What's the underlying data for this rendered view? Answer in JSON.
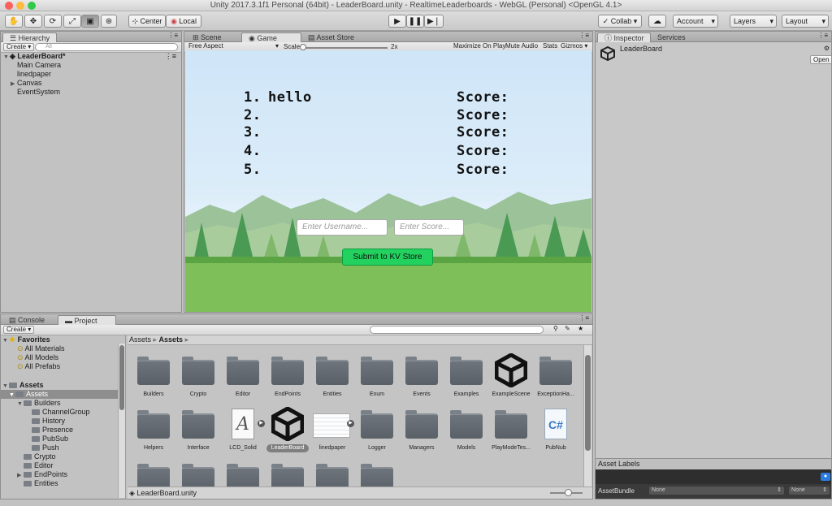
{
  "window": {
    "title": "Unity 2017.3.1f1 Personal (64bit) - LeaderBoard.unity - RealtimeLeaderboards - WebGL (Personal) <OpenGL 4.1>"
  },
  "toolbar": {
    "tools": [
      "hand-tool-icon",
      "move-tool-icon",
      "rotate-tool-icon",
      "scale-tool-icon",
      "rect-tool-icon",
      "transform-tool-icon"
    ],
    "pivot_label": "Center",
    "space_label": "Local",
    "play_controls": [
      "play-icon",
      "pause-icon",
      "step-icon"
    ],
    "collab_label": "Collab ▾",
    "account_label": "Account",
    "layers_label": "Layers",
    "layout_label": "Layout"
  },
  "hierarchy": {
    "tab_label": "Hierarchy",
    "create_label": "Create ▾",
    "search_placeholder": "All",
    "scene_name": "LeaderBoard*",
    "items": [
      "Main Camera",
      "linedpaper",
      "Canvas",
      "EventSystem"
    ]
  },
  "game": {
    "tabs": {
      "scene": "Scene",
      "game": "Game",
      "asset_store": "Asset Store"
    },
    "aspect_label": "Free Aspect",
    "scale_label": "Scale",
    "scale_value": "2x",
    "maximize_label": "Maximize On Play",
    "mute_label": "Mute Audio",
    "stats_label": "Stats",
    "gizmos_label": "Gizmos",
    "leaderboard": {
      "ranks": [
        "1.",
        "2.",
        "3.",
        "4.",
        "5."
      ],
      "names": [
        "hello",
        "",
        "",
        "",
        ""
      ],
      "score_label": "Score:"
    },
    "username_placeholder": "Enter Username...",
    "score_placeholder": "Enter Score...",
    "submit_label": "Submit to KV Store"
  },
  "inspector": {
    "tab_label": "Inspector",
    "services_label": "Services",
    "object_name": "LeaderBoard",
    "open_label": "Open",
    "asset_labels": "Asset Labels",
    "asset_bundle_label": "AssetBundle",
    "bundle_value": "None",
    "variant_value": "None"
  },
  "project": {
    "console_tab": "Console",
    "project_tab": "Project",
    "create_label": "Create ▾",
    "favorites_label": "Favorites",
    "favorites": [
      "All Materials",
      "All Models",
      "All Prefabs"
    ],
    "assets_label": "Assets",
    "assets_sub_label": "Assets",
    "tree": [
      "Builders",
      "ChannelGroup",
      "History",
      "Presence",
      "PubSub",
      "Push",
      "Crypto",
      "Editor",
      "EndPoints",
      "Entities"
    ],
    "breadcrumb": [
      "Assets",
      "Assets"
    ],
    "grid": [
      "Builders",
      "Crypto",
      "Editor",
      "EndPoints",
      "Entities",
      "Enum",
      "Events",
      "Examples",
      "ExampleScene",
      "ExceptionHa...",
      "Helpers",
      "Interface",
      "LCD_Solid",
      "LeaderBoard",
      "linedpaper",
      "Logger",
      "Managers",
      "Models",
      "PlayModeTes...",
      "PubNub"
    ],
    "status_path": "LeaderBoard.unity"
  }
}
